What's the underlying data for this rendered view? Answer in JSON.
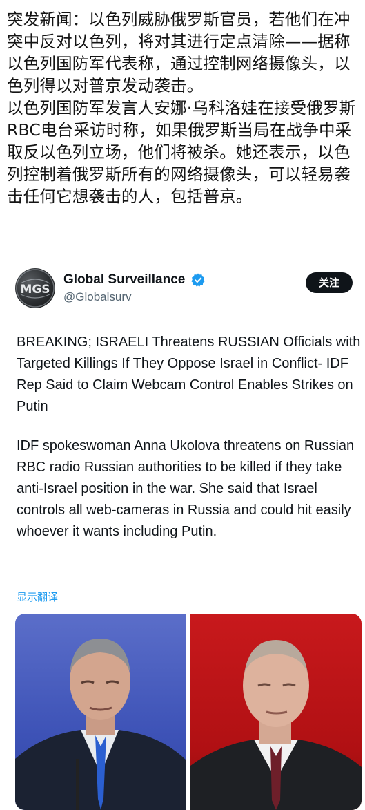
{
  "headline": {
    "paragraph_1": "突发新闻：以色列威胁俄罗斯官员，若他们在冲突中反对以色列，将对其进行定点清除——据称以色列国防军代表称，通过控制网络摄像头，以色列得以对普京发动袭击。",
    "paragraph_2": "以色列国防军发言人安娜·乌科洛娃在接受俄罗斯RBC电台采访时称，如果俄罗斯当局在战争中采取反以色列立场，他们将被杀。她还表示，以色列控制着俄罗斯所有的网络摄像头，可以轻易袭击任何它想袭击的人，包括普京。"
  },
  "tweet": {
    "avatar_text": "MGS",
    "display_name": "Global Surveillance",
    "handle": "@Globalsurv",
    "follow_label": "关注",
    "text_1": "BREAKING; ISRAELI Threatens RUSSIAN Officials with Targeted Killings If They Oppose Israel in Conflict- IDF Rep Said to Claim Webcam Control Enables Strikes on Putin",
    "text_2": "IDF spokeswoman Anna Ukolova threatens on Russian RBC radio Russian authorities to be killed if they take anti-Israel position in the war. She said that Israel controls all web-cameras in Russia and could hit easily whoever  it wants including Putin.",
    "translate_label": "显示翻译",
    "verified_color": "#1d9bf0",
    "media_count": 2
  }
}
